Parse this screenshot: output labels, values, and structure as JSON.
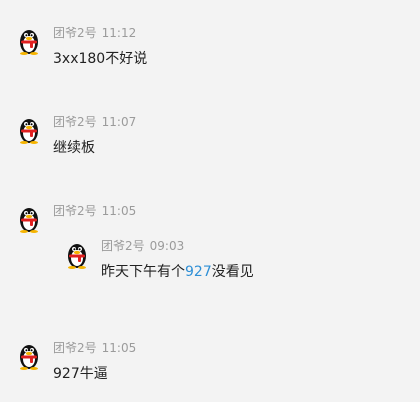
{
  "messages": [
    {
      "sender": "团爷2号",
      "time": "11:12",
      "text": "3xx180不好说"
    },
    {
      "sender": "团爷2号",
      "time": "11:07",
      "text": "继续板"
    },
    {
      "sender": "团爷2号",
      "time": "11:05",
      "quote": {
        "sender": "团爷2号",
        "time": "09:03",
        "text_before": "昨天下午有个",
        "text_highlight": "927",
        "text_after": "没看见"
      }
    },
    {
      "sender": "团爷2号",
      "time": "11:05",
      "text": "927牛逼"
    }
  ],
  "colors": {
    "background": "#f3f3f3",
    "meta": "#9b9b9b",
    "text": "#222222",
    "highlight": "#2e8fd6"
  },
  "icons": {
    "avatar": "qq-penguin-icon"
  }
}
